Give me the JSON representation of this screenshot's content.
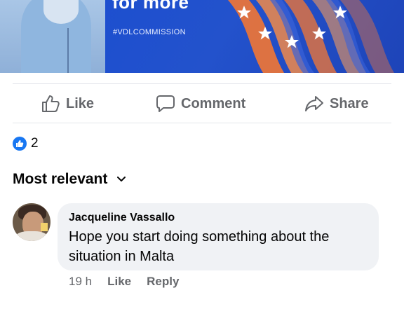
{
  "banner": {
    "headline": "for more",
    "hashtag": "#VDLCOMMISSION"
  },
  "actions": {
    "like_label": "Like",
    "comment_label": "Comment",
    "share_label": "Share"
  },
  "reactions": {
    "count": "2"
  },
  "sort": {
    "label": "Most relevant"
  },
  "comment": {
    "author": "Jacqueline Vassallo",
    "text": "Hope you start doing something about the situation in Malta",
    "time": "19 h",
    "like_label": "Like",
    "reply_label": "Reply"
  },
  "colors": {
    "accent": "#1877f2",
    "secondary_text": "#65676b",
    "bubble_bg": "#f0f2f5",
    "banner_blue": "#1d4fcf",
    "banner_orange": "#e8743b"
  }
}
